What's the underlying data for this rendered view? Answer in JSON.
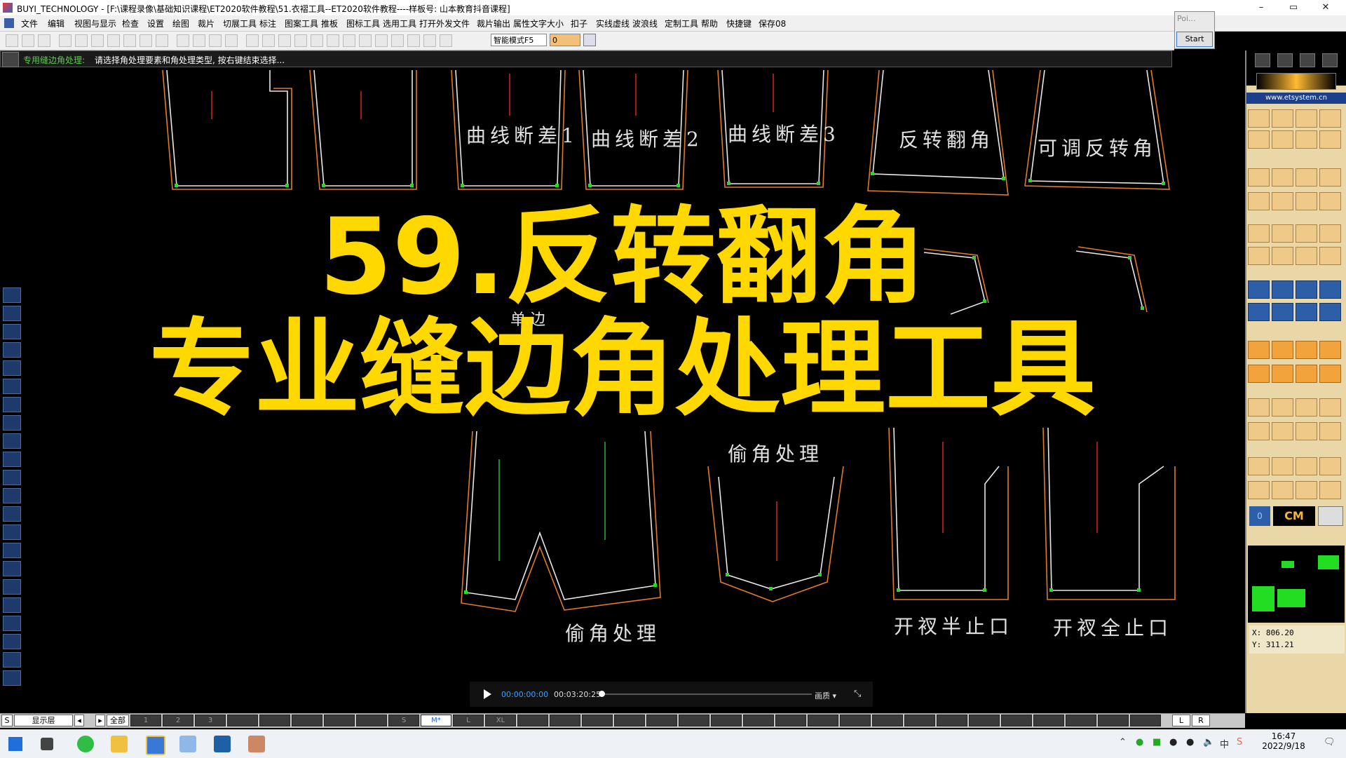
{
  "window": {
    "title": "BUYI_TECHNOLOGY - [F:\\课程录像\\基础知识课程\\ET2020软件教程\\51.衣褶工具--ET2020软件教程----样板号: 山本教育抖音课程]",
    "controls": [
      "–",
      "▭",
      "✕"
    ]
  },
  "menu": [
    "文件",
    "编辑",
    "视图与显示",
    "检查",
    "设置",
    "绘图",
    "裁片",
    "切展工具",
    "标注",
    "图案工具",
    "推板",
    "图标工具",
    "选用工具",
    "打开外发文件",
    "裁片输出",
    "属性文字大小",
    "扣子",
    "实线虚线",
    "波浪线",
    "定制工具",
    "帮助",
    "快捷键",
    "保存08"
  ],
  "toolbar": {
    "mode_select": "智能模式F5",
    "coord_value": "0"
  },
  "popup": {
    "title": "Poi...",
    "start_label": "Start"
  },
  "prompt": {
    "label": "专用缝边角处理:",
    "text": "请选择角处理要素和角处理类型, 按右键结束选择..."
  },
  "overlay": {
    "line1": "59.反转翻角",
    "line2": "专业缝边角处理工具"
  },
  "pattern_labels": {
    "curve1": "曲线断差1",
    "curve2": "曲线断差2",
    "curve3": "曲线断差3",
    "flip": "反转翻角",
    "adjustable_flip": "可调反转角",
    "single_side": "单边",
    "corner_steal_top": "偷角处理",
    "corner_steal_bottom": "偷角处理",
    "vent_half": "开衩半止口",
    "vent_full": "开衩全止口"
  },
  "right_panel": {
    "site": "www.etsystem.cn",
    "unit": "CM",
    "zero_label": "0",
    "coord_x": "X:  806.20",
    "coord_y": "Y:  311.21"
  },
  "player": {
    "current": "00:00:00:00",
    "total": "00:03:20:25",
    "quality": "画质 ▾",
    "progress": 0.0
  },
  "layerbar": {
    "s_label": "S",
    "layer_label": "显示层",
    "all_label": "全部",
    "sizes": [
      "1",
      "2",
      "3",
      "",
      "",
      "",
      "",
      "",
      "S",
      "M*",
      "L",
      "XL"
    ],
    "l_label": "L",
    "r_label": "R"
  },
  "taskbar": {
    "time": "16:47",
    "date": "2022/9/18"
  },
  "colors": {
    "overlay_yellow": "#ffd800",
    "line_white": "#e8e8e8",
    "line_orange": "#e07a2a",
    "point_green": "#22dd22",
    "grain_red": "#cc2222"
  }
}
